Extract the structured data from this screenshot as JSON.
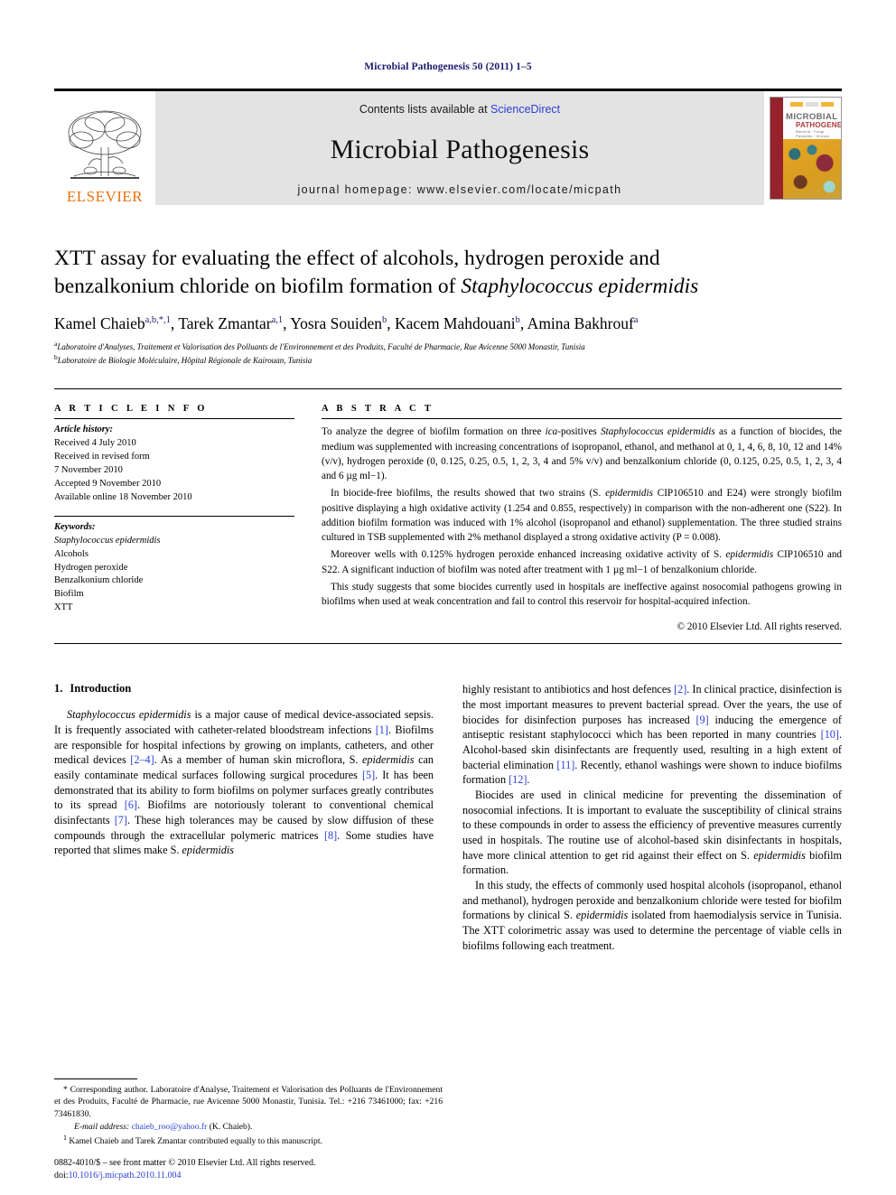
{
  "running_head": "Microbial Pathogenesis 50 (2011) 1–5",
  "banner": {
    "publisher_wordmark": "ELSEVIER",
    "contents_prefix": "Contents lists available at ",
    "contents_link": "ScienceDirect",
    "journal_title": "Microbial Pathogenesis",
    "homepage": "journal homepage: www.elsevier.com/locate/micpath",
    "cover": {
      "line1": "MICROBIAL",
      "line2": "PATHOGENESIS",
      "line3": "Bacteria · Fungi · Parasites · Viruses"
    }
  },
  "article": {
    "title_line1": "XTT assay for evaluating the effect of alcohols, hydrogen peroxide and",
    "title_line2_pre": "benzalkonium chloride on biofilm formation of ",
    "title_line2_italic": "Staphylococcus epidermidis",
    "authors": "Kamel Chaieb a,b,*,1, Tarek Zmantar a,1, Yosra Souiden b, Kacem Mahdouani b, Amina Bakhrouf a",
    "affiliation_a": "Laboratoire d'Analyses, Traitement et Valorisation des Polluants de l'Environnement et des Produits, Faculté de Pharmacie, Rue Avicenne 5000 Monastir, Tunisia",
    "affiliation_b": "Laboratoire de Biologie Moléculaire, Hôpital Régionale de Kairouan, Tunisia"
  },
  "info": {
    "heading": "A R T I C L E   I N F O",
    "history_label": "Article history:",
    "history": [
      "Received 4 July 2010",
      "Received in revised form",
      "7 November 2010",
      "Accepted 9 November 2010",
      "Available online 18 November 2010"
    ],
    "keywords_label": "Keywords:",
    "keywords": [
      "Staphylococcus epidermidis",
      "Alcohols",
      "Hydrogen peroxide",
      "Benzalkonium chloride",
      "Biofilm",
      "XTT"
    ]
  },
  "abstract": {
    "heading": "A B S T R A C T",
    "p1_a": "To analyze the degree of biofilm formation on three ",
    "p1_ica": "ica",
    "p1_b": "-positives ",
    "p1_species": "Staphylococcus epidermidis",
    "p1_c": " as a function of biocides, the medium was supplemented with increasing concentrations of isopropanol, ethanol, and methanol at 0, 1, 4, 6, 8, 10, 12 and 14% (v/v), hydrogen peroxide (0, 0.125, 0.25, 0.5, 1, 2, 3, 4 and 5% v/v) and benzalkonium chloride (0, 0.125, 0.25, 0.5, 1, 2, 3, 4 and 6 µg ml−1).",
    "p2_a": "In biocide-free biofilms, the results showed that two strains (S. ",
    "p2_species": "epidermidis",
    "p2_b": " CIP106510 and E24) were strongly biofilm positive displaying a high oxidative activity (1.254 and 0.855, respectively) in comparison with the non-adherent one (S22). In addition biofilm formation was induced with 1% alcohol (isopropanol and ethanol) supplementation. The three studied strains cultured in TSB supplemented with 2% methanol displayed a strong oxidative activity (P = 0.008).",
    "p3_a": "Moreover wells with 0.125% hydrogen peroxide enhanced increasing oxidative activity of S. ",
    "p3_species": "epidermidis",
    "p3_b": " CIP106510 and S22. A significant induction of biofilm was noted after treatment with 1 µg ml−1 of benzalkonium chloride.",
    "p4": "This study suggests that some biocides currently used in hospitals are ineffective against nosocomial pathogens growing in biofilms when used at weak concentration and fail to control this reservoir for hospital-acquired infection.",
    "copyright": "© 2010 Elsevier Ltd. All rights reserved."
  },
  "introduction": {
    "number": "1.",
    "heading": "Introduction",
    "left_p1_species": "Staphylococcus epidermidis",
    "left_p1_a": " is a major cause of medical device-associated sepsis. It is frequently associated with catheter-related bloodstream infections ",
    "left_p1_r1": "[1]",
    "left_p1_b": ". Biofilms are responsible for hospital infections by growing on implants, catheters, and other medical devices ",
    "left_p1_r2": "[2–4]",
    "left_p1_c": ". As a member of human skin microflora, S. ",
    "left_p1_ital2": "epidermidis",
    "left_p1_d": " can easily contaminate medical surfaces following surgical procedures ",
    "left_p1_r3": "[5]",
    "left_p1_e": ". It has been demonstrated that its ability to form biofilms on polymer surfaces greatly contributes to its spread ",
    "left_p1_r4": "[6]",
    "left_p1_f": ". Biofilms are notoriously tolerant to conventional chemical disinfectants ",
    "left_p1_r5": "[7]",
    "left_p1_g": ". These high tolerances may be caused by slow diffusion of these compounds through the extracellular polymeric matrices ",
    "left_p1_r6": "[8]",
    "left_p1_h": ". Some studies have reported that slimes make S. ",
    "left_p1_ital3": "epidermidis",
    "right_p1_a": "highly resistant to antibiotics and host defences ",
    "right_p1_r1": "[2]",
    "right_p1_b": ". In clinical practice, disinfection is the most important measures to prevent bacterial spread. Over the years, the use of biocides for disinfection purposes has increased ",
    "right_p1_r2": "[9]",
    "right_p1_c": " inducing the emergence of antiseptic resistant staphylococci which has been reported in many countries ",
    "right_p1_r3": "[10]",
    "right_p1_d": ". Alcohol-based skin disinfectants are frequently used, resulting in a high extent of bacterial elimination ",
    "right_p1_r4": "[11]",
    "right_p1_e": ". Recently, ethanol washings were shown to induce biofilms formation ",
    "right_p1_r5": "[12]",
    "right_p1_f": ".",
    "right_p2": "Biocides are used in clinical medicine for preventing the dissemination of nosocomial infections. It is important to evaluate the susceptibility of clinical strains to these compounds in order to assess the efficiency of preventive measures currently used in hospitals. The routine use of alcohol-based skin disinfectants in hospitals, have more clinical attention to get rid against their effect on S. ",
    "right_p2_ital": "epidermidis",
    "right_p2_end": " biofilm formation.",
    "right_p3_a": "In this study, the effects of commonly used hospital alcohols (isopropanol, ethanol and methanol), hydrogen peroxide and benzalkonium chloride were tested for biofilm formations by clinical S. ",
    "right_p3_ital": "epidermidis",
    "right_p3_b": " isolated from haemodialysis service in Tunisia. The XTT colorimetric assay was used to determine the percentage of viable cells in biofilms following each treatment."
  },
  "footnotes": {
    "corresponding": "* Corresponding author. Laboratoire d'Analyse, Traitement et Valorisation des Polluants de l'Environnement et des Produits, Faculté de Pharmacie, rue Avicenne 5000 Monastir, Tunisia. Tel.: +216 73461000; fax: +216 73461830.",
    "email_label": "E-mail address:",
    "email_link": "chaieb_roo@yahoo.fr",
    "email_suffix": " (K. Chaieb).",
    "note_marker": "1",
    "note_text": "Kamel Chaieb and Tarek Zmantar contributed equally to this manuscript.",
    "issn_line": "0882-4010/$ – see front matter © 2010 Elsevier Ltd. All rights reserved.",
    "doi_label": "doi:",
    "doi_value": "10.1016/j.micpath.2010.11.004"
  }
}
